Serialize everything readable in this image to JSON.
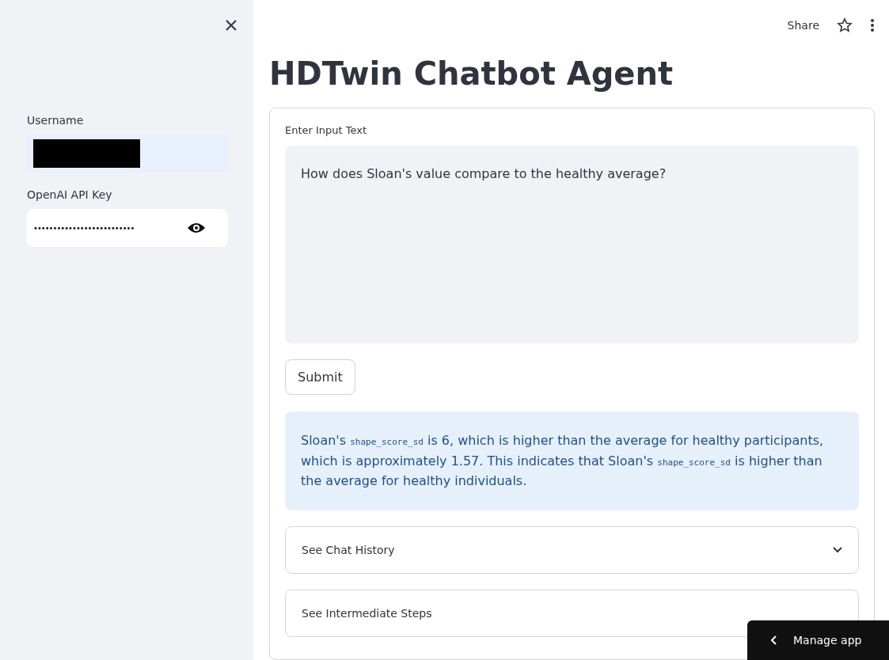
{
  "sidebar": {
    "fields": [
      {
        "label": "Username",
        "kind": "text",
        "redacted": true
      },
      {
        "label": "OpenAI API Key",
        "kind": "password",
        "value": "••••••••••••••••••••••••••"
      }
    ]
  },
  "toolbar": {
    "share": "Share"
  },
  "title": "HDTwin Chatbot Agent",
  "form": {
    "label": "Enter Input Text",
    "input": "How does Sloan's value compare to the healthy average?",
    "submit": "Submit"
  },
  "response": [
    {
      "kind": "text",
      "text": "Sloan's "
    },
    {
      "kind": "code",
      "text": "shape_score_sd"
    },
    {
      "kind": "text",
      "text": " is 6, which is higher than the average for healthy participants, which is approximately 1.57. This indicates that Sloan's "
    },
    {
      "kind": "code",
      "text": "shape_score_sd"
    },
    {
      "kind": "text",
      "text": " is higher than the average for healthy individuals."
    }
  ],
  "expanders": [
    {
      "label": "See Chat History",
      "expanded": false
    },
    {
      "label": "See Intermediate Steps"
    }
  ],
  "manage_app": "Manage app"
}
